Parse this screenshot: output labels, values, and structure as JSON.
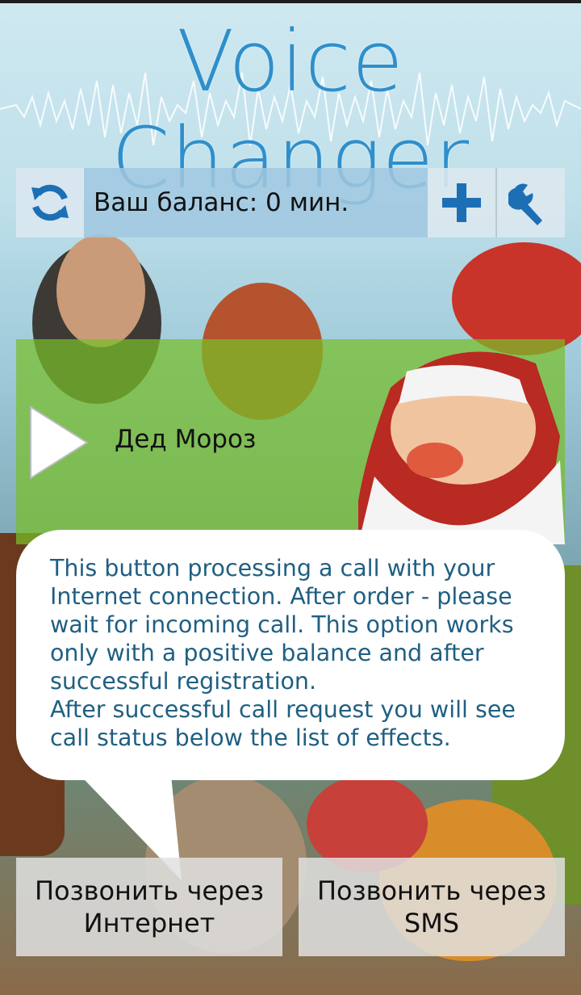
{
  "app": {
    "title": "Voice Changer"
  },
  "balance": {
    "label": "Ваш баланс: 0 мин."
  },
  "toolbar": {
    "refresh_icon": "refresh-icon",
    "add_icon": "plus-icon",
    "settings_icon": "wrench-icon"
  },
  "effect": {
    "name": "Дед Мороз",
    "play_icon": "play-icon"
  },
  "tooltip": {
    "paragraph1": "This button processing a call with your Internet connection. After order - please wait for incoming call. This option works only with a positive balance and after successful registration.",
    "paragraph2": "After successful call request you will see call status below the list of effects."
  },
  "buttons": {
    "internet_line1": "Позвонить через",
    "internet_line2": "Интернет",
    "sms_line1": "Позвонить через",
    "sms_line2": "SMS"
  },
  "colors": {
    "accent": "#2f8fcb",
    "effect_bg": "#78be28",
    "tooltip_text": "#1f5f82"
  }
}
